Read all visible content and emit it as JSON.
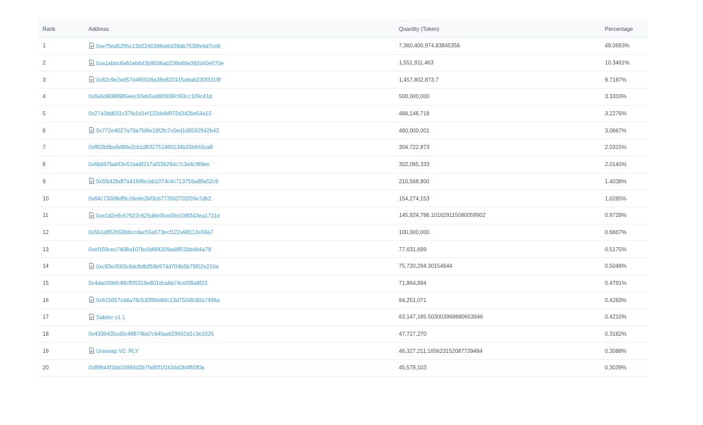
{
  "table": {
    "headers": {
      "rank": "Rank",
      "address": "Address",
      "quantity": "Quantity (Token)",
      "percentage": "Percentage"
    },
    "rows": [
      {
        "rank": "1",
        "address": "0xe75ed5295c13d224036feb6439db7539fe6d7ce8",
        "contract": true,
        "quantity": "7,360,400,974.83845356",
        "percentage": "49.0693%"
      },
      {
        "rank": "2",
        "address": "0xa1abbc8a61eb643b9036ab226b46e392d40e570e",
        "contract": true,
        "quantity": "1,551,911,463",
        "percentage": "10.3461%"
      },
      {
        "rank": "3",
        "address": "0x82c9e2ed57d465506a36e822415a6ab230f3319f",
        "contract": true,
        "quantity": "1,457,802,873.7",
        "percentage": "9.7187%"
      },
      {
        "rank": "4",
        "address": "0x9a5d9088985eec33eb5ad88309fcf43cc109c41d",
        "contract": false,
        "quantity": "500,000,000",
        "percentage": "3.3333%"
      },
      {
        "rank": "5",
        "address": "0x27a3dd031c37fa1d1ef122defd972d342be54a15",
        "contract": false,
        "quantity": "484,146,718",
        "percentage": "3.2276%"
      },
      {
        "rank": "6",
        "address": "0x772e4027a79a7fd6e19f2fc7c0ed1d6592942b43",
        "contract": true,
        "quantity": "460,000,001",
        "percentage": "3.0667%"
      },
      {
        "rank": "7",
        "address": "0xff02b6ba9d99e2cb1d832751960134b33b943ca8",
        "contract": false,
        "quantity": "304,722,873",
        "percentage": "2.0315%"
      },
      {
        "rank": "8",
        "address": "0x6b697baf43e51ba6f217af33929dc7c3e4cf89ee",
        "contract": false,
        "quantity": "302,095,333",
        "percentage": "2.0140%"
      },
      {
        "rank": "9",
        "address": "0x5fb42bdf7a4169fecbb1074c4c713756a98a52c9",
        "contract": true,
        "quantity": "210,568,800",
        "percentage": "1.4038%"
      },
      {
        "rank": "10",
        "address": "0x84c73008df9c16e6e2bf3cb773562702f26e7db2",
        "contract": false,
        "quantity": "154,274,153",
        "percentage": "1.0285%"
      },
      {
        "rank": "11",
        "address": "0xe1d2e9c67622c625d6ef3ce00e108f343ea1711d",
        "contract": true,
        "quantity": "145,924,796.101629115080059902",
        "percentage": "0.9728%"
      },
      {
        "rank": "12",
        "address": "0x5b1d852659bbccdac55a573ecf122a98112e58a7",
        "contract": false,
        "quantity": "100,000,000",
        "percentage": "0.6667%"
      },
      {
        "rank": "13",
        "address": "0xef159cec7408a107bc0d6f4209ad6f51bbdd4a78",
        "contract": false,
        "quantity": "77,631,699",
        "percentage": "0.5175%"
      },
      {
        "rank": "14",
        "address": "0xc93e3583c6dc8dfdf59b974d704b5b79f02e210a",
        "contract": true,
        "quantity": "75,720,294.30154644",
        "percentage": "0.5048%"
      },
      {
        "rank": "15",
        "address": "0x4dac00bfc49cff35319e801dca6b74ce5f9a8f23",
        "contract": false,
        "quantity": "71,864,894",
        "percentage": "0.4791%"
      },
      {
        "rank": "16",
        "address": "0x615657cd4a78c530f86e84c13d7504fc80a7496a",
        "contract": true,
        "quantity": "64,251,071",
        "percentage": "0.4283%"
      },
      {
        "rank": "17",
        "address": "Sablier v1.1",
        "contract": true,
        "quantity": "63,147,185.503003968680653946",
        "percentage": "0.4210%"
      },
      {
        "rank": "18",
        "address": "0x4336435cd0c48874ba7c64faa629662d1c3e1026",
        "contract": false,
        "quantity": "47,727,270",
        "percentage": "0.3182%"
      },
      {
        "rank": "19",
        "address": "Uniswap V2: RLY",
        "contract": true,
        "quantity": "46,327,211.165623152087739484",
        "percentage": "0.3088%"
      },
      {
        "rank": "20",
        "address": "0xf9f644f1bb10983d2b7fa80f1f1634d2b4f50f0a",
        "contract": false,
        "quantity": "45,578,103",
        "percentage": "0.3039%"
      }
    ]
  }
}
